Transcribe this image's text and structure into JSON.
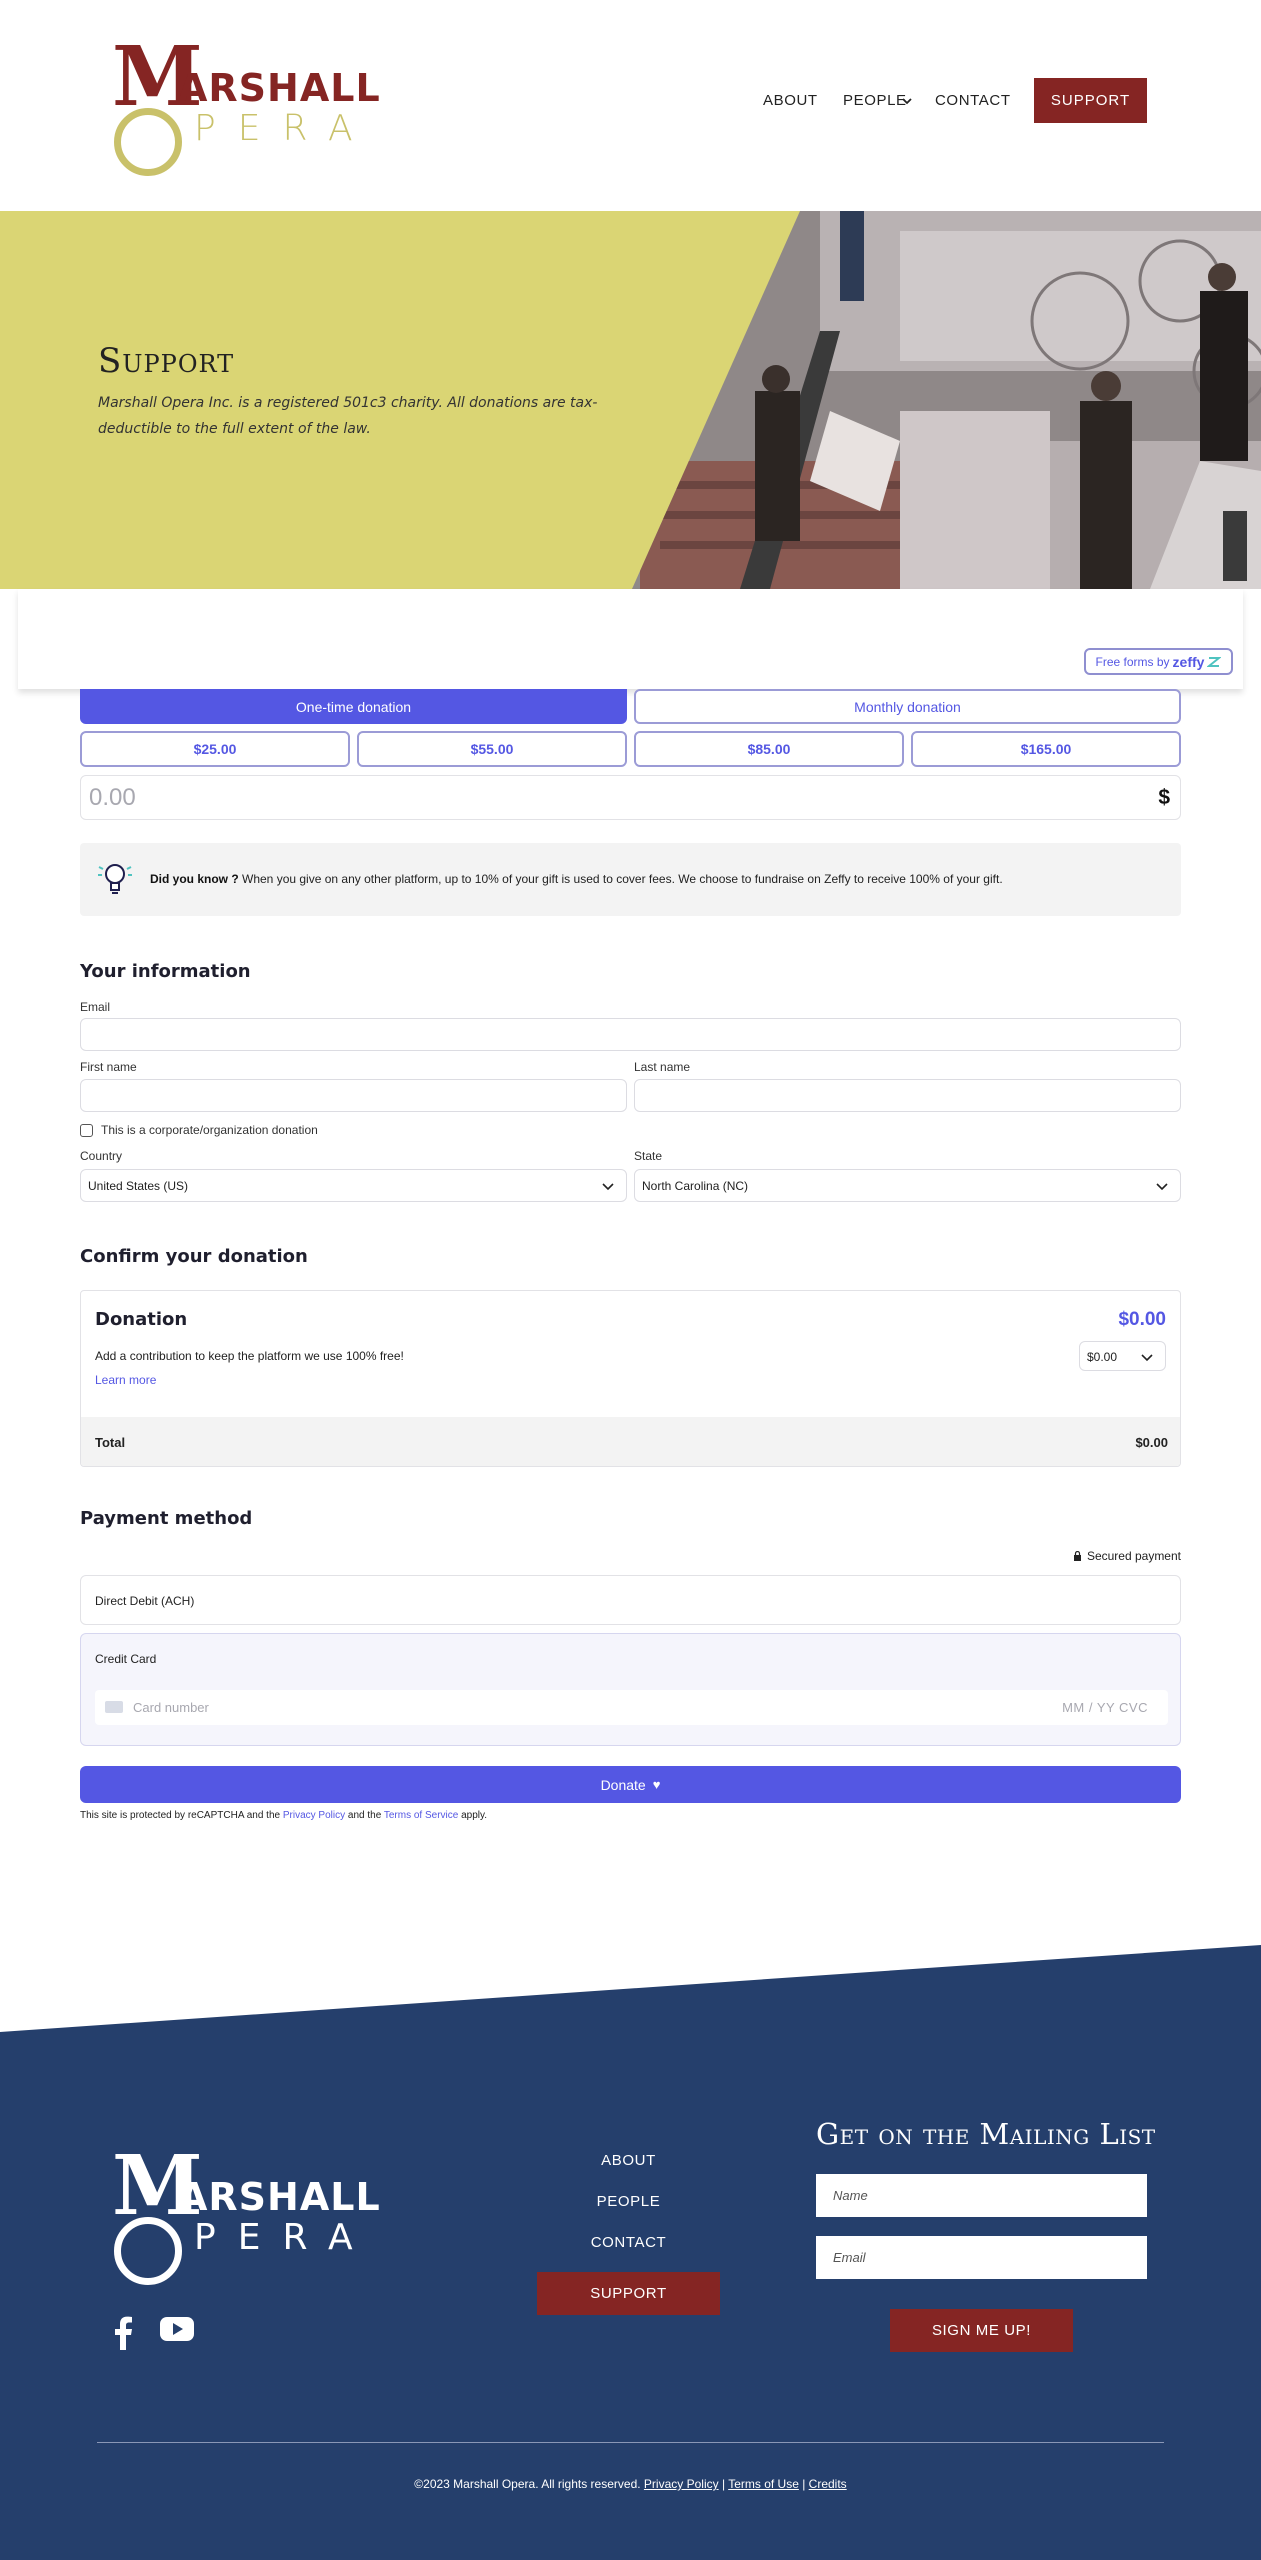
{
  "header": {
    "logo": {
      "m": "M",
      "rshall": "ARSHALL",
      "pera": "PERA"
    },
    "nav": {
      "about": "About",
      "people": "People",
      "contact": "Contact",
      "support": "Support"
    }
  },
  "hero": {
    "title": "Support",
    "text": "Marshall Opera Inc. is a registered 501c3 charity. All donations are tax-deductible to the full extent of the law."
  },
  "zeffy": {
    "badge_prefix": "Free forms by",
    "badge_brand": "zeffy"
  },
  "form": {
    "tabs": {
      "one_time": "One-time donation",
      "monthly": "Monthly donation"
    },
    "amounts": [
      "$25.00",
      "$55.00",
      "$85.00",
      "$165.00"
    ],
    "amount_placeholder": "0.00",
    "currency": "$",
    "tip": {
      "bold": "Did you know ?",
      "text": " When you give on any other platform, up to 10% of your gift is used to cover fees. We choose to fundraise on Zeffy to receive 100% of your gift."
    },
    "your_info": {
      "title": "Your information",
      "email_label": "Email",
      "first_name_label": "First name",
      "last_name_label": "Last name",
      "corporate_label": "This is a corporate/organization donation",
      "country_label": "Country",
      "country_value": "United States (US)",
      "state_label": "State",
      "state_value": "North Carolina (NC)"
    },
    "confirm": {
      "title": "Confirm your donation",
      "donation_label": "Donation",
      "donation_amount": "$0.00",
      "contribution_text": "Add a contribution to keep the platform we use 100% free!",
      "learn_more": "Learn more",
      "tip_value": "$0.00",
      "total_label": "Total",
      "total_value": "$0.00"
    },
    "payment": {
      "title": "Payment method",
      "secured": "Secured payment",
      "ach": "Direct Debit (ACH)",
      "card": "Credit Card",
      "card_placeholder": "Card number",
      "card_extra": "MM / YY  CVC"
    },
    "donate_label": "Donate",
    "recaptcha": {
      "pre": "This site is protected by reCAPTCHA and the ",
      "privacy": "Privacy Policy",
      "mid": " and the ",
      "terms": "Terms of Service",
      "post": " apply."
    }
  },
  "footer": {
    "logo": {
      "m": "M",
      "rshall": "ARSHALL",
      "pera": "PERA"
    },
    "nav": {
      "about": "About",
      "people": "People",
      "contact": "Contact",
      "support": "Support"
    },
    "mailing": {
      "title": "Get on the Mailing List",
      "name_placeholder": "Name",
      "email_placeholder": "Email",
      "button": "Sign me up!"
    },
    "copyright": {
      "text": "©2023 Marshall Opera. All rights reserved. ",
      "privacy": "Privacy Policy",
      "sep1": " | ",
      "terms": "Terms of Use",
      "sep2": " |  ",
      "credits": "Credits"
    }
  },
  "colors": {
    "brand_red": "#852523",
    "brand_yellow": "#dad574",
    "zeffy_purple": "#5457e3",
    "footer_navy": "#253f6c"
  }
}
